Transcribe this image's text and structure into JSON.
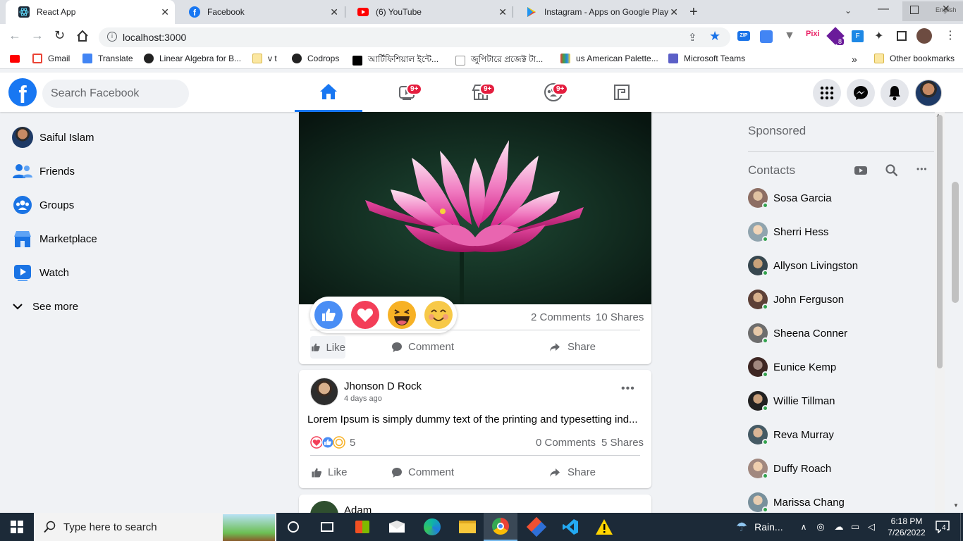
{
  "browser": {
    "tabs": [
      {
        "title": "React App",
        "icon": "react-icon"
      },
      {
        "title": "Facebook",
        "icon": "facebook-icon"
      },
      {
        "title": "(6) YouTube",
        "icon": "youtube-icon"
      },
      {
        "title": "Instagram - Apps on Google Play",
        "icon": "google-play-icon"
      }
    ],
    "corner_label": "English",
    "url": "localhost:3000",
    "bookmarks": [
      "Gmail",
      "Translate",
      "Linear Algebra for B...",
      "v t",
      "Codrops",
      "আর্টিফিশিয়াল ইন্টে...",
      "জুপিটারে প্রজেক্ট টা...",
      "us American Palette...",
      "Microsoft Teams"
    ],
    "other_bookmarks": "Other bookmarks",
    "extension_badge": "8"
  },
  "header": {
    "search_placeholder": "Search Facebook",
    "badges": [
      "9+",
      "9+",
      "9+"
    ]
  },
  "sidebar": {
    "user_name": "Saiful Islam",
    "items": [
      "Friends",
      "Groups",
      "Marketplace",
      "Watch"
    ],
    "see_more": "See more"
  },
  "feed": {
    "post1": {
      "comments": "2 Comments",
      "shares": "10 Shares",
      "like": "Like",
      "comment": "Comment",
      "share": "Share"
    },
    "post2": {
      "author": "Jhonson D Rock",
      "time": "4 days ago",
      "text": "Lorem Ipsum is simply dummy text of the printing and typesetting ind...",
      "reaction_count": "5",
      "comments": "0 Comments",
      "shares": "5 Shares",
      "like": "Like",
      "comment": "Comment",
      "share": "Share"
    },
    "post3": {
      "author": "Adam"
    }
  },
  "rightbar": {
    "sponsored": "Sponsored",
    "contacts_title": "Contacts",
    "contacts": [
      "Sosa Garcia",
      "Sherri Hess",
      "Allyson Livingston",
      "John Ferguson",
      "Sheena Conner",
      "Eunice Kemp",
      "Willie Tillman",
      "Reva Murray",
      "Duffy Roach",
      "Marissa Chang"
    ]
  },
  "taskbar": {
    "search_placeholder": "Type here to search",
    "weather": "Rain...",
    "time": "6:18 PM",
    "date": "7/26/2022",
    "notifications": "4"
  },
  "colors": {
    "fb_blue": "#1877f2",
    "badge_red": "#e41e3f",
    "love_red": "#f33e58",
    "haha_yellow": "#f7b125"
  }
}
